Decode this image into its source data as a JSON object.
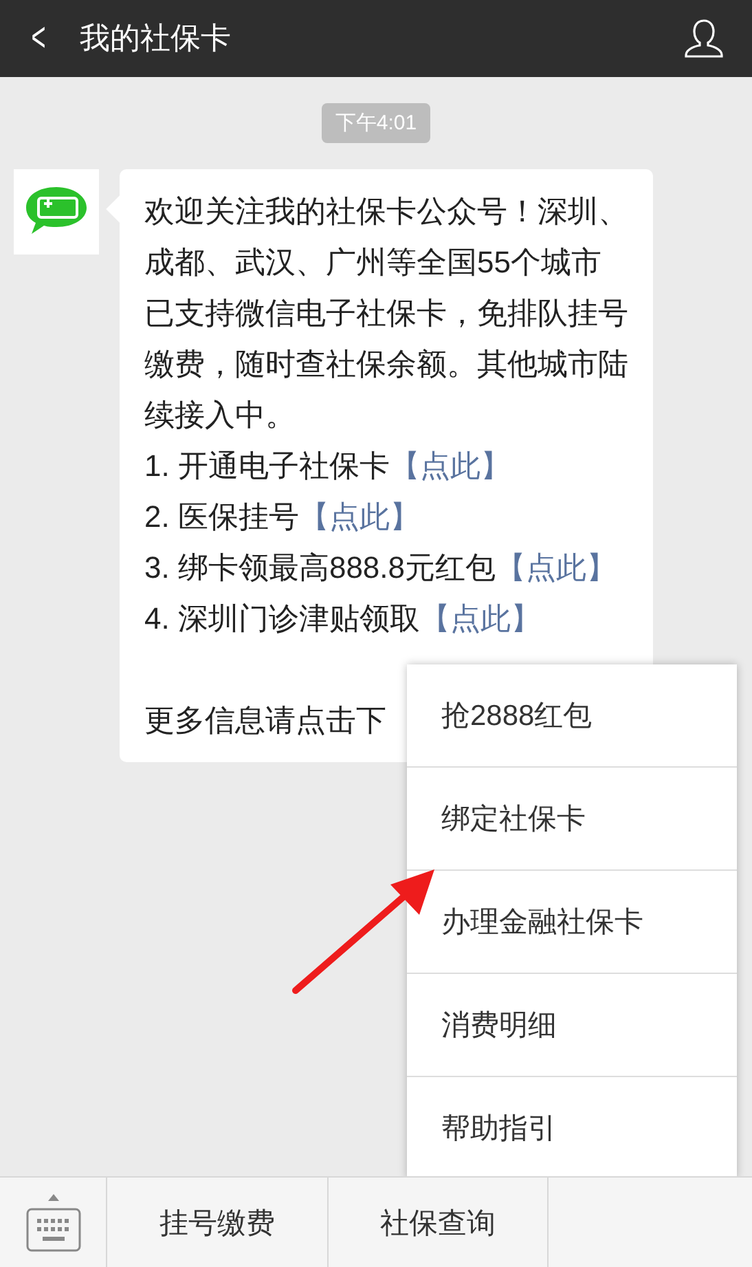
{
  "header": {
    "back": "<",
    "title": "我的社保卡"
  },
  "time": "下午4:01",
  "message": {
    "intro": "欢迎关注我的社保卡公众号！深圳、成都、武汉、广州等全国55个城市已支持微信电子社保卡，免排队挂号缴费，随时查社保余额。其他城市陆续接入中。",
    "items": [
      {
        "text": "1. 开通电子社保卡",
        "link": "【点此】"
      },
      {
        "text": "2. 医保挂号",
        "link": "【点此】"
      },
      {
        "text": "3. 绑卡领最高888.8元红包",
        "link": "【点此】"
      },
      {
        "text": "4. 深圳门诊津贴领取",
        "link": "【点此】"
      }
    ],
    "footer": "更多信息请点击下"
  },
  "popup_menu": [
    "抢2888红包",
    "绑定社保卡",
    "办理金融社保卡",
    "消费明细",
    "帮助指引"
  ],
  "bottom_bar": [
    "挂号缴费",
    "社保查询"
  ]
}
